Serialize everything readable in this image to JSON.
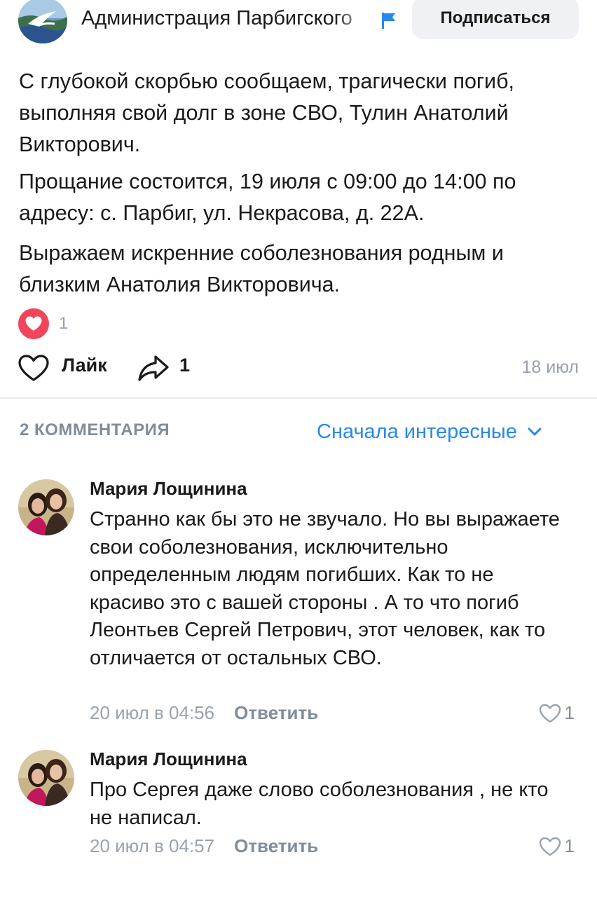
{
  "community": {
    "name": "Администрация Парбигского",
    "subscribe_label": "Подписаться"
  },
  "post": {
    "paragraphs": [
      "С глубокой скорбью сообщаем, трагически погиб, выполняя свой долг в зоне СВО, Тулин Анатолий Викторович.",
      "Прощание состоится, 19 июля с 09:00 до 14:00 по адресу: с. Парбиг, ул. Некрасова, д. 22А.",
      "Выражаем искренние соболезнования родным и близким Анатолия Викторовича."
    ],
    "reaction_count": "1",
    "like_label": "Лайк",
    "share_count": "1",
    "date": "18 июл"
  },
  "comments_section": {
    "count_label": "2 КОММЕНТАРИЯ",
    "sort_label": "Сначала интересные",
    "comments": [
      {
        "author": "Мария Лощинина",
        "text": "Странно как бы это не звучало. Но вы выражаете свои соболезнования, исключительно определенным людям погибших. Как то не красиво это с вашей стороны . А то что погиб Леонтьев Сергей Петрович, этот человек, как то отличается от остальных  СВО.",
        "date": "20 июл в 04:56",
        "reply_label": "Ответить",
        "likes": "1"
      },
      {
        "author": "Мария Лощинина",
        "text": "Про Сергея даже слово соболезнования , не кто не написал.",
        "date": "20 июл в 04:57",
        "reply_label": "Ответить",
        "likes": "1"
      }
    ]
  },
  "colors": {
    "accent": "#2688eb",
    "reaction": "#f2455c",
    "secondary_text": "#99a2ad"
  },
  "icons": [
    "community-avatar",
    "flag-icon",
    "heart-reaction-icon",
    "like-heart-icon",
    "share-arrow-icon",
    "chevron-down-icon",
    "comment-like-icon"
  ]
}
